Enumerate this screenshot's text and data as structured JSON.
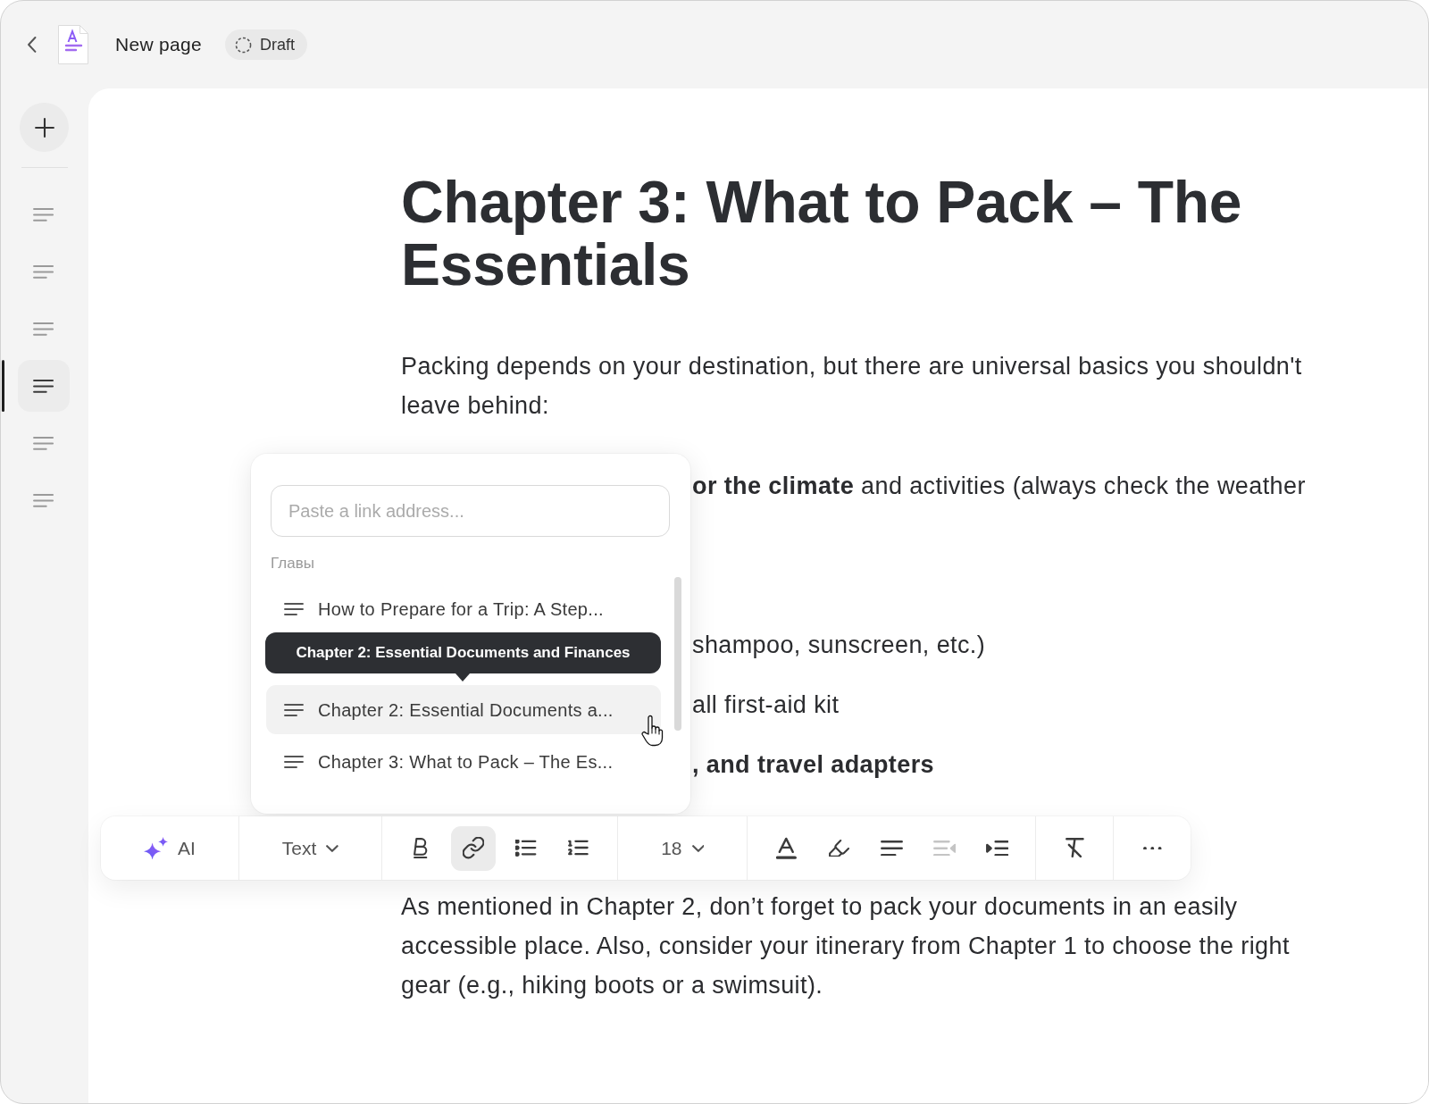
{
  "header": {
    "page_title": "New page",
    "status": "Draft"
  },
  "sidebar": {
    "items": [
      {
        "selected": false
      },
      {
        "selected": false
      },
      {
        "selected": false
      },
      {
        "selected": true
      },
      {
        "selected": false
      },
      {
        "selected": false
      }
    ]
  },
  "document": {
    "title": "Chapter 3: What to Pack – The Essentials",
    "blocks": [
      {
        "kind": "paragraph",
        "bold": false,
        "text": "Packing depends on your destination, but there are universal basics you shouldn't leave behind:"
      },
      {
        "kind": "partial_line",
        "bold": false,
        "text": "**or the climate** and activities (always check the weather"
      },
      {
        "kind": "partial_line",
        "bold": false,
        "text": "shampoo, sunscreen, etc.)"
      },
      {
        "kind": "partial_line",
        "bold": false,
        "text": "all first-aid kit"
      },
      {
        "kind": "partial_line",
        "bold": true,
        "text": ", and travel adapters"
      },
      {
        "kind": "paragraph",
        "bold": false,
        "text": "As mentioned in Chapter 2, don’t forget to pack your documents in an easily accessible place. Also, consider your itinerary from Chapter 1 to choose the right gear (e.g., hiking boots or a swimsuit)."
      }
    ]
  },
  "link_popup": {
    "placeholder": "Paste a link address...",
    "section_label": "Главы",
    "items": [
      {
        "label": "How to Prepare for a Trip: A Step...",
        "selected": false
      },
      {
        "label": "Chapter 2: Essential Documents a...",
        "selected": true,
        "tooltip": "Chapter 2: Essential Documents and Finances"
      },
      {
        "label": "Chapter 3: What to Pack – The Es...",
        "selected": false
      }
    ]
  },
  "toolbar": {
    "groups": [
      [
        {
          "kind": "ai",
          "label": "AI",
          "active": false,
          "disabled": false
        }
      ],
      [
        {
          "kind": "style_dropdown",
          "label": "Text",
          "active": false,
          "disabled": false
        }
      ],
      [
        {
          "kind": "bold",
          "active": false,
          "disabled": false
        },
        {
          "kind": "link",
          "active": true,
          "disabled": false
        },
        {
          "kind": "bullet_list",
          "active": false,
          "disabled": false
        },
        {
          "kind": "numbered_list",
          "active": false,
          "disabled": false
        }
      ],
      [
        {
          "kind": "size_dropdown",
          "label": "18",
          "active": false,
          "disabled": false
        }
      ],
      [
        {
          "kind": "text_color",
          "active": false,
          "disabled": false
        },
        {
          "kind": "highlight",
          "active": false,
          "disabled": false
        },
        {
          "kind": "align_left",
          "active": false,
          "disabled": false
        },
        {
          "kind": "outdent",
          "active": false,
          "disabled": true
        },
        {
          "kind": "indent",
          "active": false,
          "disabled": false
        }
      ],
      [
        {
          "kind": "clear_format",
          "active": false,
          "disabled": false
        }
      ],
      [
        {
          "kind": "more",
          "active": false,
          "disabled": false
        }
      ]
    ]
  }
}
